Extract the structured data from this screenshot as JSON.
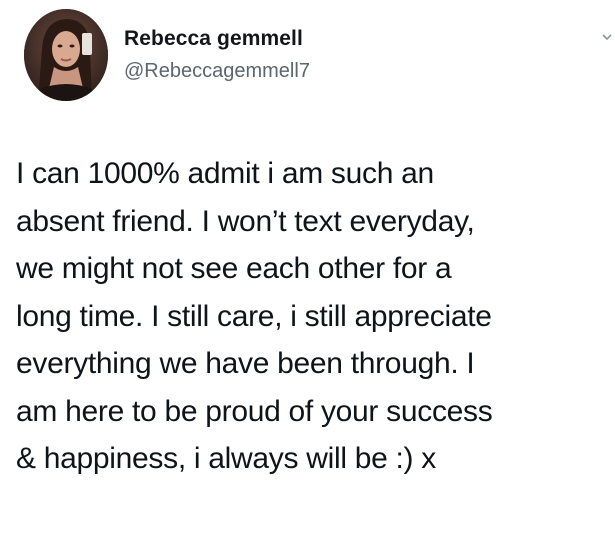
{
  "tweet": {
    "author_name": "Rebecca gemmell",
    "author_handle": "@Rebeccagemmell7",
    "avatar_icon": "profile-photo",
    "body_lines": [
      "I can 1000% admit i am such an",
      "absent friend. I won’t text everyday,",
      "we might not see each other for a",
      "long time. I still care, i still appreciate",
      "everything we have been through. I",
      "am here to be proud of your success",
      "& happiness, i always will be :) x"
    ]
  },
  "colors": {
    "name": "#14171a",
    "handle": "#5b6670",
    "text": "#0f1419",
    "background": "#ffffff"
  }
}
